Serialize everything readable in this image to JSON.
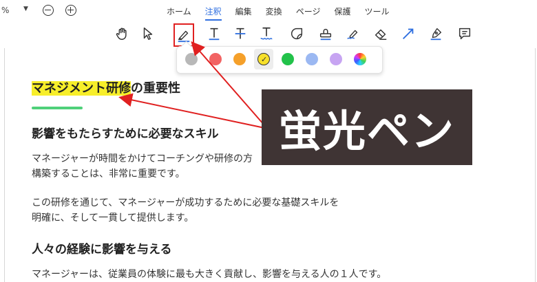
{
  "topbar": {
    "zoom_text": "%",
    "zoom_caret": "▼",
    "tabs": [
      "ホーム",
      "注釈",
      "編集",
      "変換",
      "ページ",
      "保護",
      "ツール"
    ],
    "active_tab": "注釈"
  },
  "toolbar": {
    "tools": [
      "hand-icon",
      "select-arrow-icon",
      "highlighter-icon",
      "underline-text-icon",
      "strikethrough-text-icon",
      "squiggly-underline-icon",
      "sticky-note-icon",
      "stamp-icon",
      "signature-pen-icon",
      "eraser-icon",
      "arrow-line-icon",
      "pen-icon",
      "comment-icon"
    ],
    "selected_tool": "highlighter-icon"
  },
  "color_popup": {
    "colors": [
      "#b8b8b8",
      "#f26363",
      "#f5a02a",
      "#f7e02a",
      "#22c24a",
      "#9bb8f2",
      "#c7a4f2"
    ],
    "selected_color": "#f7e02a",
    "check_mark": "✓",
    "rainbow": "color-wheel-icon"
  },
  "document": {
    "title_highlighted": "マネジメント研修",
    "title_rest": "の重要性",
    "heading1": "影響をもたらすために必要なスキル",
    "para1_line1": "マネージャーが時間をかけてコーチングや研修の方",
    "para1_line2": "構築することは、非常に重要です。",
    "para2_line1": "この研修を通じて、マネージャーが成功するために必要な基礎スキルを",
    "para2_line2": "明確に、そして一貫して提供します。",
    "heading2": "人々の経験に影響を与える",
    "para3_line1": "マネージャーは、従業員の体験に最も大きく貢献し、影響を与える人の１人です。"
  },
  "callout": {
    "text": "蛍光ペン",
    "background": "#3f3434",
    "arrow_color": "#e02020"
  }
}
